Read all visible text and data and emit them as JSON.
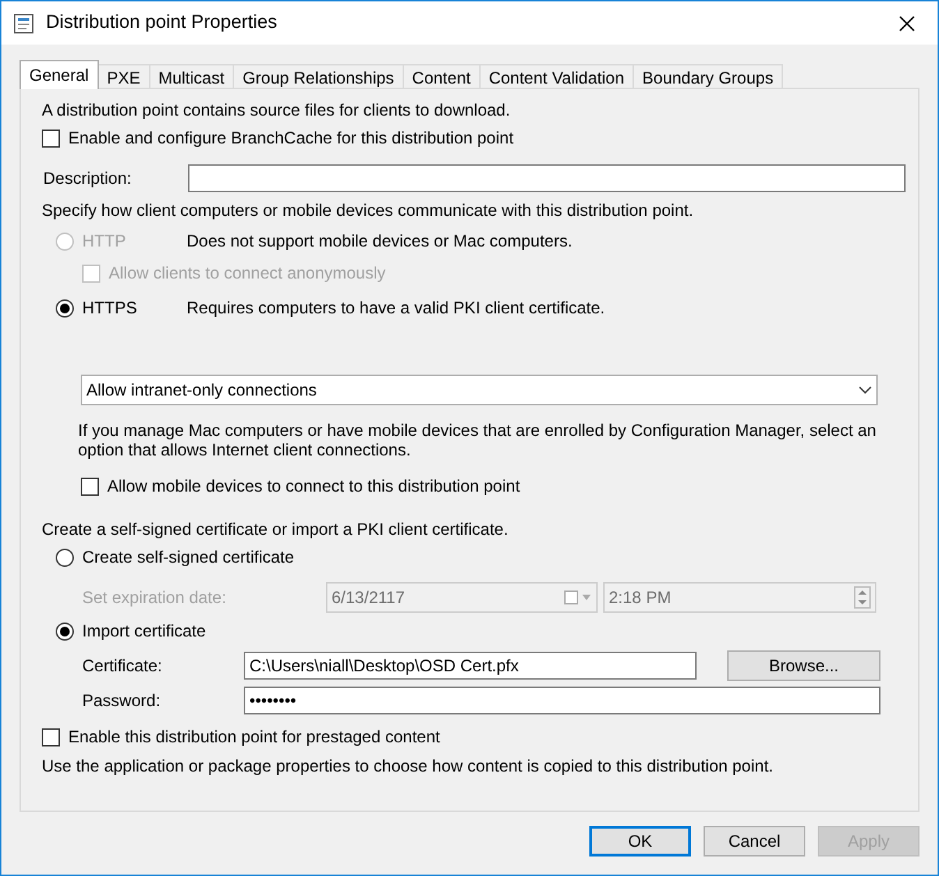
{
  "window": {
    "title": "Distribution point Properties"
  },
  "tabs": [
    {
      "label": "General",
      "selected": true
    },
    {
      "label": "PXE",
      "selected": false
    },
    {
      "label": "Multicast",
      "selected": false
    },
    {
      "label": "Group Relationships",
      "selected": false
    },
    {
      "label": "Content",
      "selected": false
    },
    {
      "label": "Content Validation",
      "selected": false
    },
    {
      "label": "Boundary Groups",
      "selected": false
    }
  ],
  "general": {
    "intro": "A distribution point contains source files for clients to download.",
    "branchcache": {
      "label": "Enable and configure BranchCache for this distribution point",
      "checked": false
    },
    "description": {
      "label": "Description:"
    },
    "communicate_text": "Specify how client computers or mobile devices communicate with this distribution point.",
    "http": {
      "label": "HTTP",
      "note": "Does not support mobile devices or Mac computers.",
      "selected": false,
      "disabled": true
    },
    "anonymous": {
      "label": "Allow clients to connect anonymously",
      "checked": false,
      "disabled": true
    },
    "https": {
      "label": "HTTPS",
      "note": "Requires computers to have a valid PKI client certificate.",
      "selected": true,
      "disabled": false
    },
    "connections": {
      "value": "Allow intranet-only connections"
    },
    "mac_note": "If you manage Mac computers or have mobile devices that are enrolled by Configuration Manager, select an option that allows Internet client connections.",
    "mobile": {
      "label": "Allow mobile devices to connect to this distribution point",
      "checked": false
    },
    "cert_intro": "Create a self-signed certificate or import a PKI client certificate.",
    "self_signed": {
      "label": "Create self-signed certificate",
      "selected": false
    },
    "expiration": {
      "label": "Set expiration date:",
      "date": "6/13/2117",
      "time": "2:18 PM",
      "disabled": true
    },
    "import": {
      "label": "Import certificate",
      "selected": true
    },
    "certificate": {
      "label": "Certificate:",
      "value": "C:\\Users\\niall\\Desktop\\OSD Cert.pfx"
    },
    "browse": {
      "label": "Browse..."
    },
    "password": {
      "label": "Password:",
      "value": "••••••••"
    },
    "prestaged": {
      "label": "Enable this distribution point for prestaged content",
      "checked": false
    },
    "footer_note": "Use the application or package properties to choose how content is copied to this distribution point."
  },
  "buttons": [
    {
      "label": "OK",
      "default": true,
      "disabled": false
    },
    {
      "label": "Cancel",
      "default": false,
      "disabled": false
    },
    {
      "label": "Apply",
      "default": false,
      "disabled": true
    }
  ]
}
